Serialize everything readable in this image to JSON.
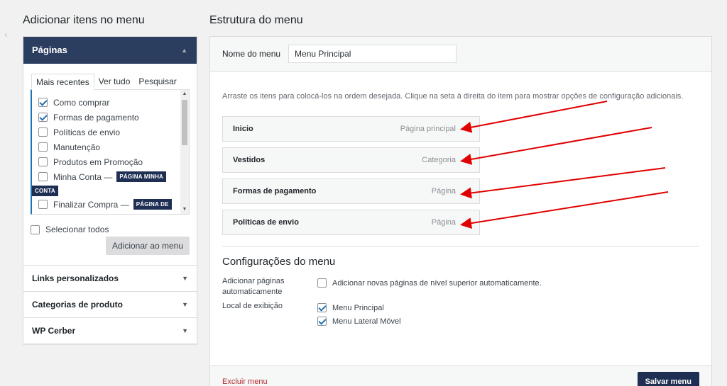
{
  "left": {
    "title": "Adicionar itens no menu",
    "pages_section": {
      "label": "Páginas",
      "tabs": [
        {
          "label": "Mais recentes",
          "active": true
        },
        {
          "label": "Ver tudo",
          "active": false
        },
        {
          "label": "Pesquisar",
          "active": false
        }
      ],
      "items": [
        {
          "label": "Como comprar",
          "checked": true
        },
        {
          "label": "Formas de pagamento",
          "checked": true
        },
        {
          "label": "Políticas de envio",
          "checked": false
        },
        {
          "label": "Manutenção",
          "checked": false
        },
        {
          "label": "Produtos em Promoção",
          "checked": false
        },
        {
          "label": "Minha Conta —",
          "checked": false,
          "badge": "PÁGINA MINHA",
          "badge2": "CONTA"
        },
        {
          "label": "Finalizar Compra —",
          "checked": false,
          "badge": "PÁGINA DE"
        }
      ],
      "select_all": "Selecionar todos",
      "add_button": "Adicionar ao menu"
    },
    "other_sections": [
      {
        "label": "Links personalizados"
      },
      {
        "label": "Categorias de produto"
      },
      {
        "label": "WP Cerber"
      }
    ]
  },
  "right": {
    "title": "Estrutura do menu",
    "name_label": "Nome do menu",
    "name_value": "Menu Principal",
    "instructions": "Arraste os itens para colocá-los na ordem desejada. Clique na seta à direita do item para mostrar opções de configuração adicionais.",
    "menu_items": [
      {
        "title": "Inicio",
        "type": "Página principal"
      },
      {
        "title": "Vestidos",
        "type": "Categoria"
      },
      {
        "title": "Formas de pagamento",
        "type": "Página"
      },
      {
        "title": "Políticas de envio",
        "type": "Página"
      }
    ],
    "config": {
      "title": "Configurações do menu",
      "auto_add_label_1": "Adicionar páginas",
      "auto_add_label_2": "automaticamente",
      "auto_add_option": "Adicionar novas páginas de nível superior automaticamente.",
      "auto_add_checked": false,
      "location_label": "Local de exibição",
      "locations": [
        {
          "label": "Menu Principal",
          "checked": true
        },
        {
          "label": "Menu Lateral Móvel",
          "checked": true
        }
      ]
    },
    "delete_link": "Excluir menu",
    "save_button": "Salvar menu"
  },
  "colors": {
    "accent_dark": "#1e2f53",
    "active_header": "#2c3e60",
    "annotation_arrow": "#e00000",
    "delete": "#b32d2e"
  }
}
